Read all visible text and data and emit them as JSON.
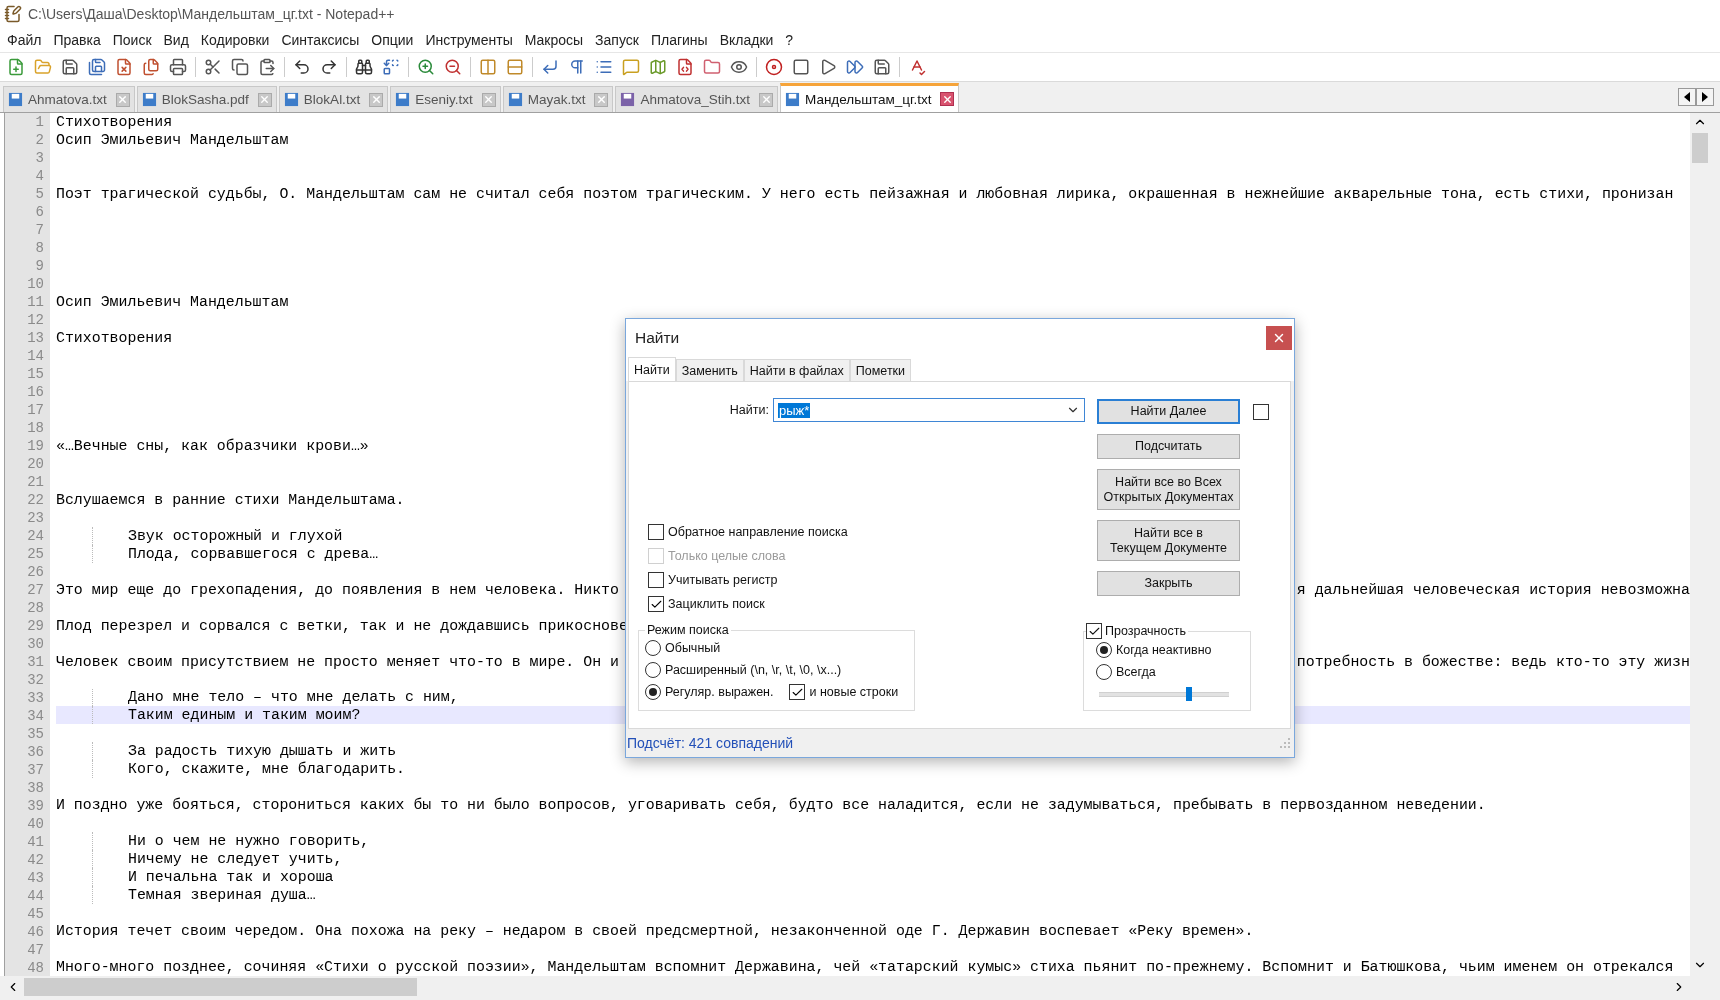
{
  "window": {
    "title": "C:\\Users\\Даша\\Desktop\\Мандельштам_цг.txt - Notepad++"
  },
  "menu": [
    "Файл",
    "Правка",
    "Поиск",
    "Вид",
    "Кодировки",
    "Синтаксисы",
    "Опции",
    "Инструменты",
    "Макросы",
    "Запуск",
    "Плагины",
    "Вкладки",
    "?"
  ],
  "tabs": [
    {
      "label": "Ahmatova.txt",
      "selected": false,
      "color": "#3d7cc9"
    },
    {
      "label": "BlokSasha.pdf",
      "selected": false,
      "color": "#3d7cc9"
    },
    {
      "label": "BlokAl.txt",
      "selected": false,
      "color": "#3d7cc9"
    },
    {
      "label": "Eseniy.txt",
      "selected": false,
      "color": "#3d7cc9"
    },
    {
      "label": "Mayak.txt",
      "selected": false,
      "color": "#3d7cc9"
    },
    {
      "label": "Ahmatova_Stih.txt",
      "selected": false,
      "color": "#7b62a8"
    },
    {
      "label": "Мандельштам_цг.txt",
      "selected": true,
      "color": "#3d7cc9"
    }
  ],
  "editor": {
    "lines": [
      {
        "number": "1",
        "text": "Стихотворения",
        "indented": false,
        "current": false
      },
      {
        "number": "2",
        "text": "Осип Эмильевич Мандельштам",
        "indented": false,
        "current": false
      },
      {
        "number": "3",
        "indented": false,
        "current": false
      },
      {
        "number": "4",
        "indented": false,
        "current": false
      },
      {
        "number": "5",
        "text": "Поэт трагической судьбы, О. Мандельштам сам не считал себя поэтом трагическим. У него есть пейзажная и любовная лирика, окрашенная в нежнейшие акварельные тона, есть стихи, пронизан",
        "indented": false,
        "current": false
      },
      {
        "number": "6",
        "indented": false,
        "current": false
      },
      {
        "number": "7",
        "indented": false,
        "current": false
      },
      {
        "number": "8",
        "indented": false,
        "current": false
      },
      {
        "number": "9",
        "indented": false,
        "current": false
      },
      {
        "number": "10",
        "indented": false,
        "current": false
      },
      {
        "number": "11",
        "text": "Осип Эмильевич Мандельштам",
        "indented": false,
        "current": false
      },
      {
        "number": "12",
        "indented": false,
        "current": false
      },
      {
        "number": "13",
        "text": "Стихотворения",
        "indented": false,
        "current": false
      },
      {
        "number": "14",
        "indented": false,
        "current": false
      },
      {
        "number": "15",
        "indented": false,
        "current": false
      },
      {
        "number": "16",
        "indented": false,
        "current": false
      },
      {
        "number": "17",
        "indented": false,
        "current": false
      },
      {
        "number": "18",
        "indented": false,
        "current": false
      },
      {
        "number": "19",
        "text": "«…Вечные сны, как образчики крови…»",
        "indented": false,
        "current": false
      },
      {
        "number": "20",
        "indented": false,
        "current": false
      },
      {
        "number": "21",
        "indented": false,
        "current": false
      },
      {
        "number": "22",
        "text": "Вслушаемся в ранние стихи Мандельштама.",
        "indented": false,
        "current": false
      },
      {
        "number": "23",
        "indented": false,
        "current": false
      },
      {
        "number": "24",
        "text": "Звук осторожный и глухой",
        "indented": true,
        "current": false
      },
      {
        "number": "25",
        "text": "Плода, сорвавшегося с древа…",
        "indented": true,
        "current": false
      },
      {
        "number": "26",
        "indented": false,
        "current": false
      },
      {
        "number": "27",
        "text": "Это мир еще до грехопадения, до появления в нем человека. Никто",
        "text_right": "я дальнейшая человеческая история невозможна",
        "indented": false,
        "current": false
      },
      {
        "number": "28",
        "indented": false,
        "current": false
      },
      {
        "number": "29",
        "text": "Плод перезрел и сорвался с ветки, так и не дождавшись прикоснове",
        "indented": false,
        "current": false
      },
      {
        "number": "30",
        "indented": false,
        "current": false
      },
      {
        "number": "31",
        "text": "Человек своим присутствием не просто меняет что-то в мире. Он и",
        "text_right": "потребность в божестве: ведь кто-то эту жизн",
        "indented": false,
        "current": false
      },
      {
        "number": "32",
        "indented": false,
        "current": false
      },
      {
        "number": "33",
        "text": "Дано мне тело – что мне делать с ним,",
        "indented": true,
        "current": false
      },
      {
        "number": "34",
        "text": "Таким единым и таким моим?",
        "indented": true,
        "current": true
      },
      {
        "number": "35",
        "indented": false,
        "current": false
      },
      {
        "number": "36",
        "text": "За радость тихую дышать и жить",
        "indented": true,
        "current": false
      },
      {
        "number": "37",
        "text": "Кого, скажите, мне благодарить.",
        "indented": true,
        "current": false
      },
      {
        "number": "38",
        "indented": false,
        "current": false
      },
      {
        "number": "39",
        "text": "И поздно уже бояться, сторониться каких бы то ни было вопросов, уговаривать себя, будто все наладится, если не задумываться, пребывать в первозданном неведении.",
        "indented": false,
        "current": false
      },
      {
        "number": "40",
        "indented": false,
        "current": false
      },
      {
        "number": "41",
        "text": "Ни о чем не нужно говорить,",
        "indented": true,
        "current": false
      },
      {
        "number": "42",
        "text": "Ничему не следует учить,",
        "indented": true,
        "current": false
      },
      {
        "number": "43",
        "text": "И печальна так и хороша",
        "indented": true,
        "current": false
      },
      {
        "number": "44",
        "text": "Темная звериная душа…",
        "indented": true,
        "current": false
      },
      {
        "number": "45",
        "indented": false,
        "current": false
      },
      {
        "number": "46",
        "text": "История течет своим чередом. Она похожа на реку – недаром в своей предсмертной, незаконченной оде Г. Державин воспевает «Реку времен».",
        "indented": false,
        "current": false
      },
      {
        "number": "47",
        "indented": false,
        "current": false
      },
      {
        "number": "48",
        "text": "Много-много позднее, сочиняя «Стихи о русской поэзии», Мандельштам вспомнит Державина, чей «татарский кумыс» стиха пьянит по-прежнему. Вспомнит и Батюшкова, чьим именем он отрекался",
        "indented": false,
        "current": false
      }
    ]
  },
  "find_dialog": {
    "title": "Найти",
    "tabs": [
      {
        "label": "Найти",
        "selected": true
      },
      {
        "label": "Заменить",
        "selected": false
      },
      {
        "label": "Найти в файлах",
        "selected": false
      },
      {
        "label": "Пометки",
        "selected": false
      }
    ],
    "find_label": "Найти:",
    "find_value": "рыж*",
    "buttons": [
      {
        "label": "Найти Далее",
        "default": true
      },
      {
        "label": "Подсчитать",
        "default": false
      },
      {
        "label": "Найти все во Всех\nОткрытых Документах",
        "default": false
      },
      {
        "label": "Найти все в\nТекущем Документе",
        "default": false
      },
      {
        "label": "Закрыть",
        "default": false
      }
    ],
    "side_checkbox": {
      "checked": false
    },
    "options": [
      {
        "label": "Обратное направление поиска",
        "checked": false,
        "disabled": false
      },
      {
        "label": "Только целые слова",
        "checked": false,
        "disabled": true
      },
      {
        "label": "Учитывать регистр",
        "checked": false,
        "disabled": false
      },
      {
        "label": "Зациклить поиск",
        "checked": true,
        "disabled": false
      }
    ],
    "search_mode": {
      "title": "Режим поиска",
      "options": [
        {
          "label": "Обычный",
          "selected": false
        },
        {
          "label": "Расширенный (\\n, \\r, \\t, \\0, \\x...)",
          "selected": false
        },
        {
          "label": "Регуляр. выражен.",
          "selected": true
        }
      ],
      "newlines": {
        "label": "и новые строки",
        "checked": true
      }
    },
    "transparency": {
      "label": "Прозрачность",
      "checked": true,
      "options": [
        {
          "label": "Когда неактивно",
          "selected": true
        },
        {
          "label": "Всегда",
          "selected": false
        }
      ],
      "level": 0.7
    },
    "status": "Подсчёт: 421 совпадений"
  }
}
